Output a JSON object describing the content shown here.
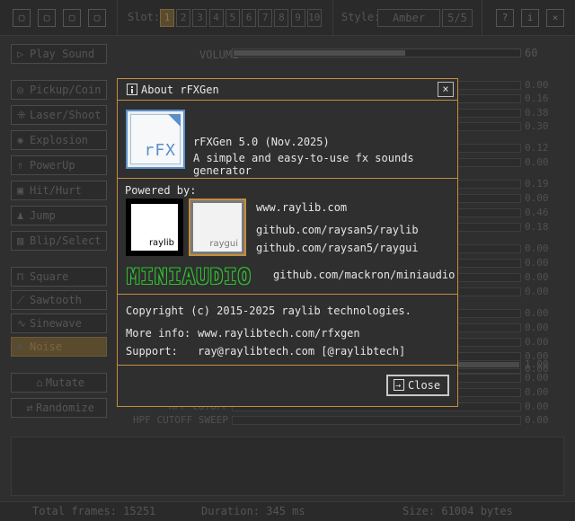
{
  "toolbar": {
    "slot_label": "Slot:",
    "slots": [
      "1",
      "2",
      "3",
      "4",
      "5",
      "6",
      "7",
      "8",
      "9",
      "10"
    ],
    "active_slot": "1",
    "style_label": "Style:",
    "style_value": "Amber",
    "style_counter": "5/5",
    "icons": [
      "new-file-icon",
      "open-file-icon",
      "save-file-icon",
      "export-file-icon"
    ],
    "right_icons": [
      "help-icon",
      "info-icon",
      "quit-icon"
    ]
  },
  "left_panel": {
    "play_sound": "Play Sound",
    "generators": [
      "Pickup/Coin",
      "Laser/Shoot",
      "Explosion",
      "PowerUp",
      "Hit/Hurt",
      "Jump",
      "Blip/Select"
    ],
    "waves": [
      "Square",
      "Sawtooth",
      "Sinewave",
      "Noise"
    ],
    "active_wave": "Noise",
    "mutate": "Mutate",
    "randomize": "Randomize"
  },
  "params": {
    "volume_label": "VOLUME",
    "volume_value": "60",
    "volume_fraction": 0.6,
    "values": [
      "0.00",
      "0.16",
      "0.38",
      "0.30",
      "0.12",
      "0.00",
      "0.19",
      "0.00",
      "0.46",
      "0.18",
      "0.00",
      "0.00",
      "0.00",
      "0.00",
      "0.00",
      "0.00",
      "0.00",
      "0.00",
      "0.00",
      "1.00",
      "0.00",
      "0.00",
      "0.00",
      "0.00",
      "0.00"
    ],
    "hpf_label": "HPF CUTOFF SWEEP",
    "hpf_cutoff_label": "HPF CUTOFF",
    "hpf_value": "0.00"
  },
  "status": {
    "frames": "Total frames: 15251",
    "duration": "Duration: 345 ms",
    "size": "Size: 61004 bytes"
  },
  "dialog": {
    "title": "About rFXGen",
    "close_x": "×",
    "app_name": "rFXGen 5.0 (Nov.2025)",
    "app_desc": "A simple and easy-to-use fx sounds generator",
    "logo_text": "rFX",
    "powered_by": "Powered by:",
    "raylib_logo": "raylib",
    "raygui_logo": "raygui",
    "raylib_url": "www.raylib.com",
    "raylib_github": "github.com/raysan5/raylib",
    "raygui_github": "github.com/raysan5/raygui",
    "miniaudio_logo": "MINIAUDIO",
    "miniaudio_github": "github.com/mackron/miniaudio",
    "copyright": "Copyright (c) 2015-2025 raylib technologies.",
    "more_info_label": "More info:",
    "more_info_url": "www.raylibtech.com/rfxgen",
    "support_label": "Support:",
    "support_value": "ray@raylibtech.com [@raylibtech]",
    "close_button": "Close"
  }
}
